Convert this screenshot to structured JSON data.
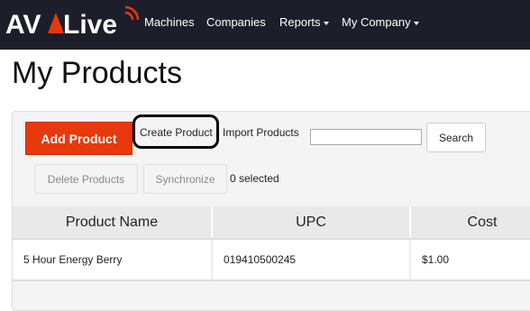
{
  "navbar": {
    "logo_text": "AV Live",
    "items": [
      {
        "label": "Machines"
      },
      {
        "label": "Companies"
      },
      {
        "label": "Reports"
      },
      {
        "label": "My Company"
      }
    ]
  },
  "page": {
    "title": "My Products"
  },
  "toolbar": {
    "add_product": "Add Product",
    "create_product": "Create Product",
    "import_products": "Import Products",
    "search_placeholder": "",
    "search_button": "Search",
    "delete_products": "Delete Products",
    "synchronize": "Synchronize",
    "selected_count": "0 selected"
  },
  "table": {
    "headers": [
      "Product Name",
      "UPC",
      "Cost"
    ],
    "rows": [
      [
        "5 Hour Energy Berry",
        "019410500245",
        "$1.00"
      ]
    ]
  },
  "colors": {
    "navbar": "#1e1e2a",
    "accent": "#e8380d"
  }
}
